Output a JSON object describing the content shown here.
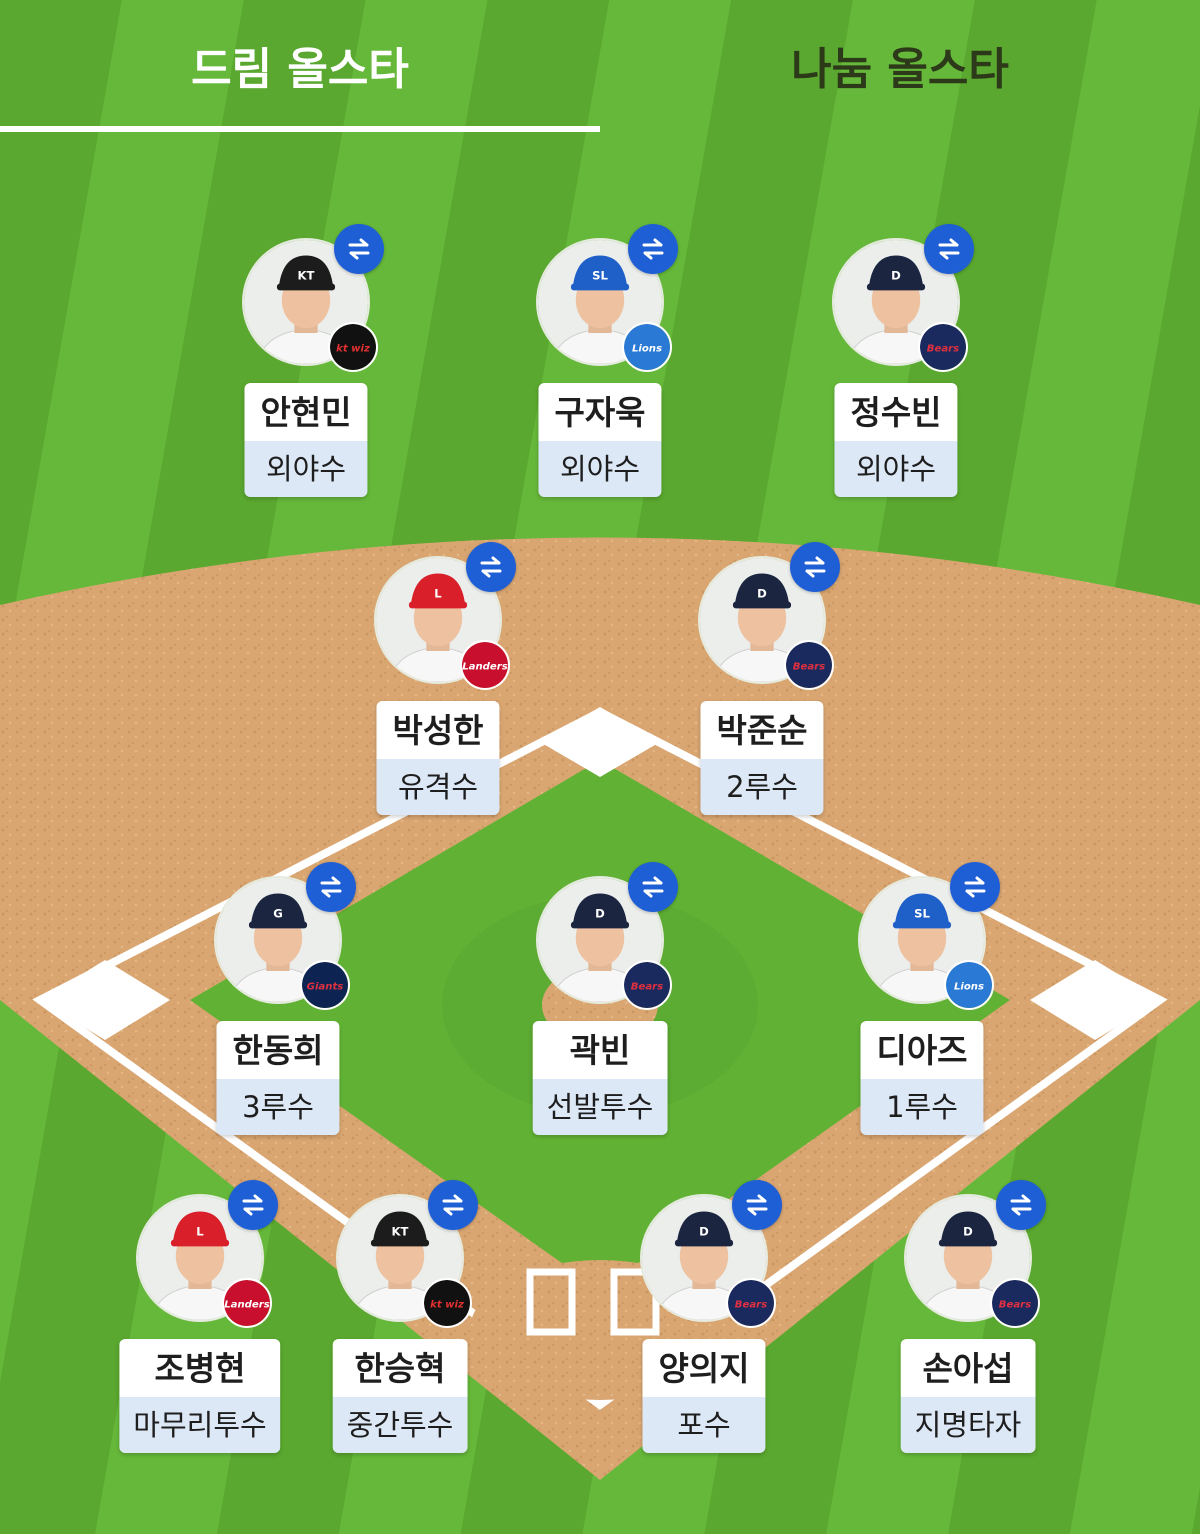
{
  "tabs": [
    {
      "label": "드림 올스타",
      "active": true
    },
    {
      "label": "나눔 올스타",
      "active": false
    }
  ],
  "colors": {
    "grass": "#5aa82f",
    "dirt": "#d9a671",
    "accent_blue": "#1f5fd6",
    "position_bg": "#dde8f7"
  },
  "swap_icon": "swap-arrows-icon",
  "players": [
    {
      "name": "안현민",
      "position": "외야수",
      "team": "kt wiz",
      "cap": "#1c1c1c",
      "cap_mark": "KT",
      "badge_bg": "#111111",
      "badge_fg": "#e03030"
    },
    {
      "name": "구자욱",
      "position": "외야수",
      "team": "Lions",
      "cap": "#1f5fc8",
      "cap_mark": "SL",
      "badge_bg": "#2a79d4",
      "badge_fg": "#ffffff"
    },
    {
      "name": "정수빈",
      "position": "외야수",
      "team": "Bears",
      "cap": "#1b2540",
      "cap_mark": "D",
      "badge_bg": "#1b2a5e",
      "badge_fg": "#e03040"
    },
    {
      "name": "박성한",
      "position": "유격수",
      "team": "Landers",
      "cap": "#d81f2a",
      "cap_mark": "L",
      "badge_bg": "#c8102e",
      "badge_fg": "#ffffff"
    },
    {
      "name": "박준순",
      "position": "2루수",
      "team": "Bears",
      "cap": "#1b2540",
      "cap_mark": "D",
      "badge_bg": "#1b2a5e",
      "badge_fg": "#e03040"
    },
    {
      "name": "한동희",
      "position": "3루수",
      "team": "Giants",
      "cap": "#1b2540",
      "cap_mark": "G",
      "badge_bg": "#0d2452",
      "badge_fg": "#e03040"
    },
    {
      "name": "곽빈",
      "position": "선발투수",
      "team": "Bears",
      "cap": "#1b2540",
      "cap_mark": "D",
      "badge_bg": "#1b2a5e",
      "badge_fg": "#e03040"
    },
    {
      "name": "디아즈",
      "position": "1루수",
      "team": "Lions",
      "cap": "#1f5fc8",
      "cap_mark": "SL",
      "badge_bg": "#2a79d4",
      "badge_fg": "#ffffff"
    },
    {
      "name": "조병현",
      "position": "마무리투수",
      "team": "Landers",
      "cap": "#d81f2a",
      "cap_mark": "L",
      "badge_bg": "#c8102e",
      "badge_fg": "#ffffff"
    },
    {
      "name": "한승혁",
      "position": "중간투수",
      "team": "kt wiz",
      "cap": "#1c1c1c",
      "cap_mark": "KT",
      "badge_bg": "#111111",
      "badge_fg": "#e03030"
    },
    {
      "name": "양의지",
      "position": "포수",
      "team": "Bears",
      "cap": "#1b2540",
      "cap_mark": "D",
      "badge_bg": "#1b2a5e",
      "badge_fg": "#e03040"
    },
    {
      "name": "손아섭",
      "position": "지명타자",
      "team": "Bears",
      "cap": "#1b2540",
      "cap_mark": "D",
      "badge_bg": "#1b2a5e",
      "badge_fg": "#e03040"
    }
  ]
}
